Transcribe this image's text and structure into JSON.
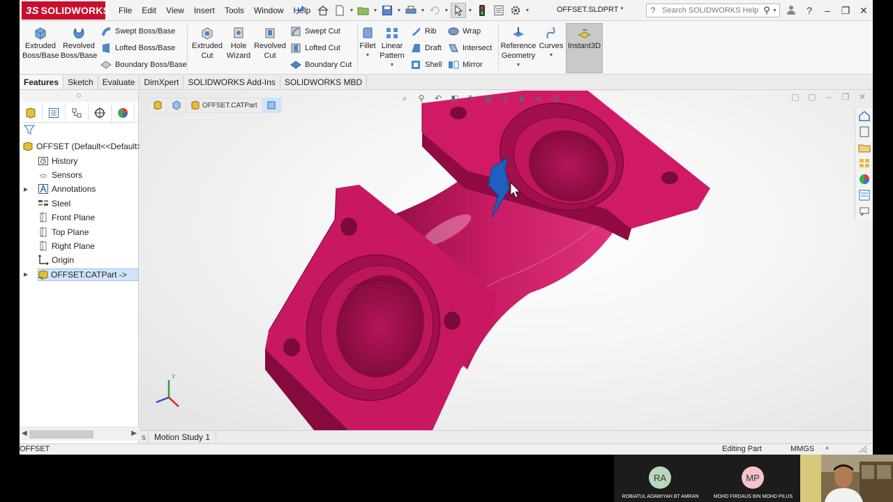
{
  "app": {
    "brand": "SOLIDWORKS",
    "brand_prefix": "3S",
    "menu": [
      "File",
      "Edit",
      "View",
      "Insert",
      "Tools",
      "Window",
      "Help"
    ],
    "document_title": "OFFSET.SLDPRT *",
    "search_placeholder": "Search SOLIDWORKS Help",
    "accent_color": "#c8102e"
  },
  "ribbon": {
    "extruded_boss": "Extruded Boss/Base",
    "revolved_boss": "Revolved Boss/Base",
    "swept_boss": "Swept Boss/Base",
    "lofted_boss": "Lofted Boss/Base",
    "boundary_boss": "Boundary Boss/Base",
    "extruded_cut": "Extruded Cut",
    "hole_wizard": "Hole Wizard",
    "revolved_cut": "Revolved Cut",
    "swept_cut": "Swept Cut",
    "lofted_cut": "Lofted Cut",
    "boundary_cut": "Boundary Cut",
    "fillet": "Fillet",
    "linear_pattern": "Linear Pattern",
    "rib": "Rib",
    "draft": "Draft",
    "shell": "Shell",
    "wrap": "Wrap",
    "intersect": "Intersect",
    "mirror": "Mirror",
    "reference_geometry": "Reference Geometry",
    "curves": "Curves",
    "instant3d": "Instant3D"
  },
  "command_tabs": [
    "Features",
    "Sketch",
    "Evaluate",
    "DimXpert",
    "SOLIDWORKS Add-Ins",
    "SOLIDWORKS MBD"
  ],
  "tree": {
    "root": "OFFSET  (Default<<Default>_",
    "items": [
      "History",
      "Sensors",
      "Annotations",
      "Steel",
      "Front Plane",
      "Top Plane",
      "Right Plane",
      "Origin",
      "OFFSET.CATPart ->"
    ]
  },
  "viewport": {
    "breadcrumb_part": "OFFSET.CATPart",
    "model_color": "#c2145e",
    "selected_face_color": "#1f5fbf",
    "triad": {
      "y": "Y"
    }
  },
  "bottom_tabs": [
    "s",
    "Motion Study 1"
  ],
  "status": {
    "part_name": "OFFSET",
    "mode": "Editing Part",
    "units": "MMGS",
    "units_arrow": "˄"
  },
  "meeting": {
    "participants": [
      {
        "initials": "RA",
        "name": "ROBIATUL ADAWIYAH BT AMRAN",
        "color": "#b9d7b9"
      },
      {
        "initials": "MP",
        "name": "MOHD FIRDAUS BIN MOHD PILUS",
        "color": "#f3c5c9"
      }
    ]
  }
}
